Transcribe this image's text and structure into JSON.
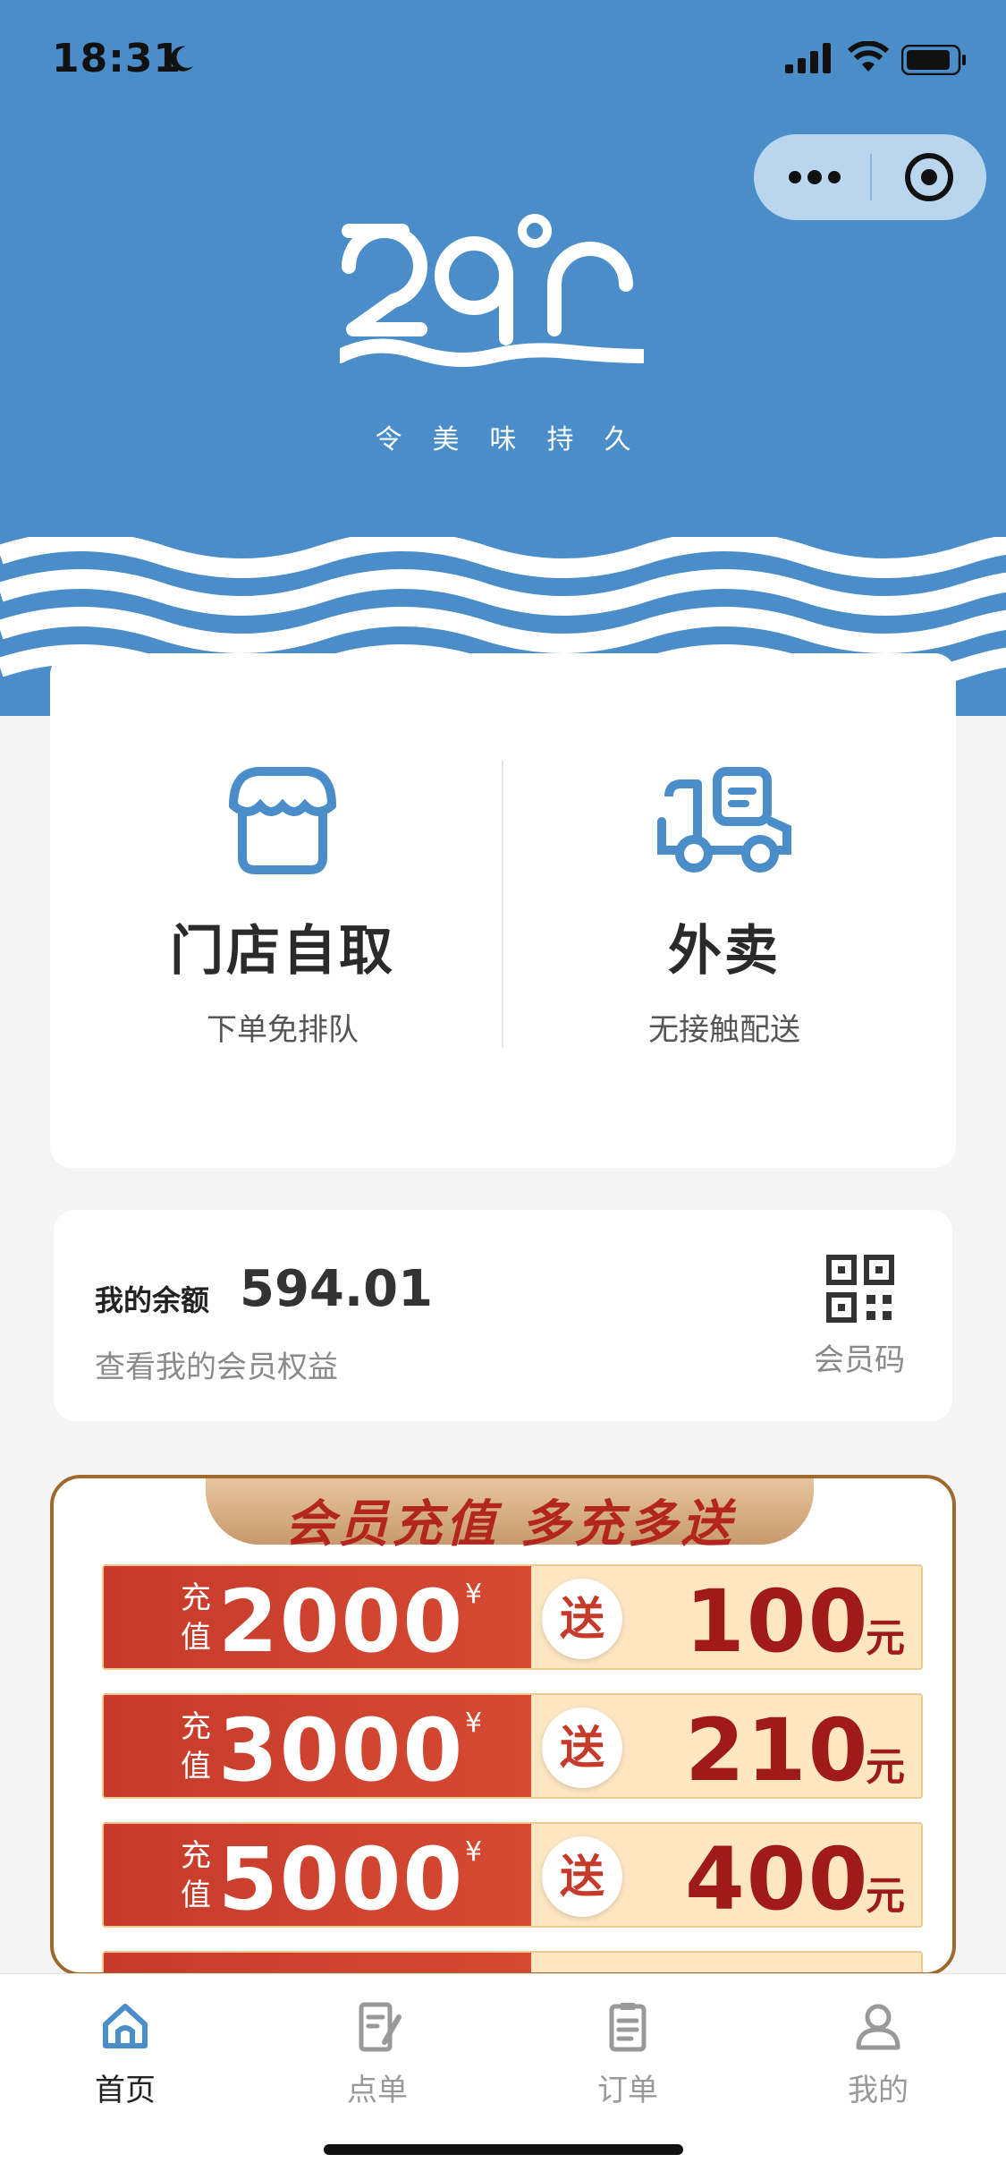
{
  "status_bar": {
    "time": "18:31"
  },
  "header": {
    "slogan": "令美味持久",
    "colors": {
      "brand_blue": "#4a8dc8",
      "white": "#ffffff"
    }
  },
  "service": {
    "pickup": {
      "title": "门店自取",
      "subtitle": "下单免排队",
      "icon": "storefront-icon"
    },
    "delivery": {
      "title": "外卖",
      "subtitle": "无接触配送",
      "icon": "delivery-truck-icon"
    }
  },
  "balance": {
    "label": "我的余额",
    "value": "594.01",
    "link": "查看我的会员权益",
    "qr_label": "会员码"
  },
  "promo": {
    "title": "会员充值 多充多送",
    "tiers": [
      {
        "prefix": "充值",
        "amount": "2000",
        "currency": "¥",
        "give": "送",
        "bonus": "100",
        "unit": "元"
      },
      {
        "prefix": "充值",
        "amount": "3000",
        "currency": "¥",
        "give": "送",
        "bonus": "210",
        "unit": "元"
      },
      {
        "prefix": "充值",
        "amount": "5000",
        "currency": "¥",
        "give": "送",
        "bonus": "400",
        "unit": "元"
      }
    ]
  },
  "tabs": [
    {
      "label": "首页",
      "icon": "home-icon",
      "active": true
    },
    {
      "label": "点单",
      "icon": "order-menu-icon",
      "active": false
    },
    {
      "label": "订单",
      "icon": "clipboard-icon",
      "active": false
    },
    {
      "label": "我的",
      "icon": "profile-icon",
      "active": false
    }
  ]
}
